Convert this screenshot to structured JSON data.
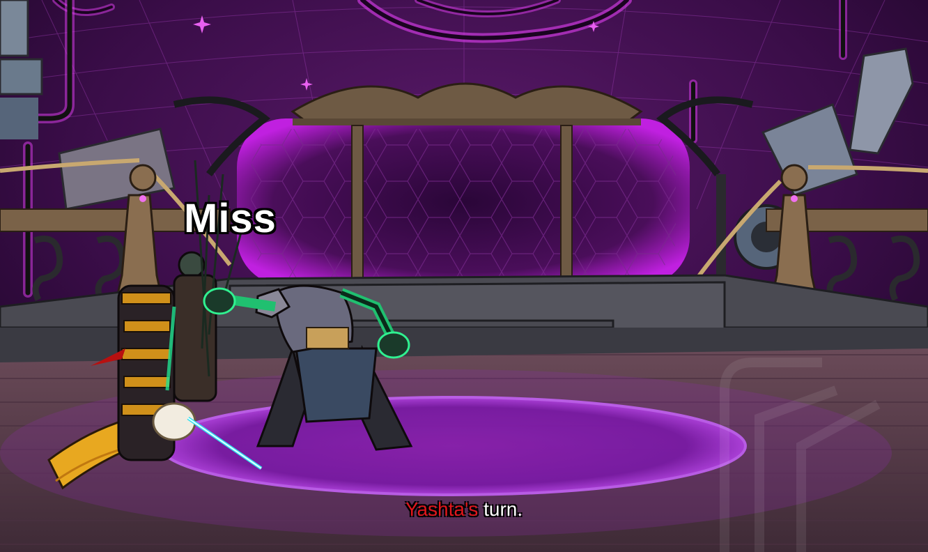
{
  "battle": {
    "float_text": "Miss",
    "turn_name": "Yashta's",
    "turn_suffix": " turn.",
    "turn_name_color": "#e0161c",
    "accent_color": "#c020e0"
  },
  "scene": {
    "player": "armored-dragon-warrior",
    "enemy": "horned-beast-brute",
    "arena": "purple-void-stage"
  }
}
